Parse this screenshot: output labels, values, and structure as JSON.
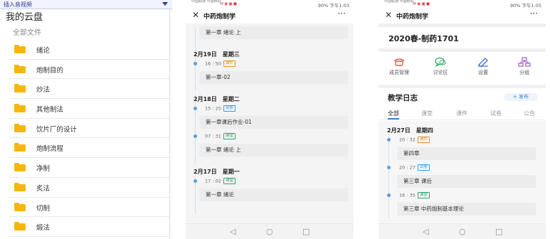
{
  "cloud": {
    "insert_bar_label": "插入音视频",
    "title": "我的云盘",
    "all_files_label": "全部文件",
    "folders": [
      "绪论",
      "炮制目的",
      "炒法",
      "其他制法",
      "饮片厂的设计",
      "炮制流程",
      "净制",
      "炙法",
      "切制",
      "煅法"
    ],
    "folder_icon": "folder-icon",
    "folder_color": "#f6b60c"
  },
  "phone2": {
    "status": {
      "carrier": "中国联通 中国移动",
      "right": "90% 下午1:03"
    },
    "nav": {
      "close": "✕",
      "title": "中药炮制学",
      "more": "···"
    },
    "entries": [
      {
        "type": "item",
        "text": "第一章 绪论 上"
      },
      {
        "type": "date",
        "text": "2月19日　星期三"
      },
      {
        "type": "time",
        "time": "16 : 50",
        "tag": "课件",
        "tag_kind": "kj"
      },
      {
        "type": "item",
        "text": "第一章-02"
      },
      {
        "type": "date",
        "text": "2月18日　星期二"
      },
      {
        "type": "time",
        "time": "15 : 25",
        "tag": "试卷",
        "tag_kind": "sj"
      },
      {
        "type": "item",
        "text": "第一章课后作业-01"
      },
      {
        "type": "time",
        "time": "07 : 31",
        "tag": "课堂",
        "tag_kind": "kt"
      },
      {
        "type": "item",
        "text": "第一章 绪论 上"
      },
      {
        "type": "date",
        "text": "2月17日　星期一"
      },
      {
        "type": "time",
        "time": "17 : 02",
        "tag": "课堂",
        "tag_kind": "kt"
      },
      {
        "type": "item",
        "text": "第一章 绪论"
      }
    ],
    "bottom": {
      "back": "◁",
      "home": "○",
      "recent": "□"
    }
  },
  "phone3": {
    "status": {
      "carrier": "中国联通 中国移动",
      "right": "90% 下午1:05"
    },
    "nav": {
      "close": "✕",
      "title": "中药炮制学",
      "more": "···"
    },
    "class_name": "2020春-制药1701",
    "menu": [
      {
        "label": "成员管理",
        "icon": "members-icon",
        "color": "#e0564d"
      },
      {
        "label": "讨论区",
        "icon": "discussion-icon",
        "color": "#3cb371"
      },
      {
        "label": "设置",
        "icon": "settings-pen-icon",
        "color": "#3a6fd0"
      },
      {
        "label": "分组",
        "icon": "group-icon",
        "color": "#9b59c9"
      }
    ],
    "log_title": "教学日志",
    "publish_label": "+ 发布",
    "tabs": [
      "全部",
      "课堂",
      "课件",
      "试卷",
      "公告"
    ],
    "entries": [
      {
        "type": "date",
        "text": "2月27日　星期四"
      },
      {
        "type": "time",
        "time": "20 : 32",
        "tag": "课件",
        "tag_kind": "kj"
      },
      {
        "type": "item",
        "text": "第四章"
      },
      {
        "type": "time",
        "time": "20 : 27",
        "tag": "试卷",
        "tag_kind": "sj"
      },
      {
        "type": "item",
        "text": "第三章 课后"
      },
      {
        "type": "time",
        "time": "16 : 35",
        "tag": "课堂",
        "tag_kind": "kt"
      },
      {
        "type": "item",
        "text": "第三章 中药炮制基本理论"
      }
    ],
    "bottom": {
      "back": "◁",
      "home": "○",
      "recent": "□"
    }
  }
}
